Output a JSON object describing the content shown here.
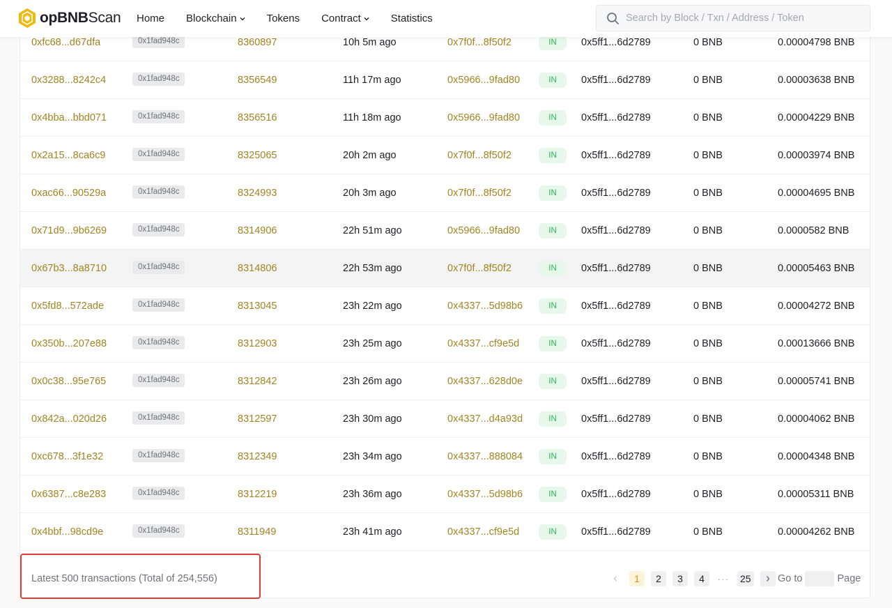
{
  "brand": {
    "name_bold": "opBNB",
    "name_regular": "Scan",
    "color": "#f0b90b"
  },
  "nav": {
    "home": "Home",
    "blockchain": "Blockchain",
    "tokens": "Tokens",
    "contract": "Contract",
    "statistics": "Statistics"
  },
  "search": {
    "placeholder": "Search by Block / Txn / Address / Token",
    "value": ""
  },
  "colors": {
    "link": "#a28521",
    "in_badge_bg": "#e7f7ea",
    "in_badge_text": "#2fb45a",
    "highlight": "#e23a36"
  },
  "transactions": [
    {
      "hash": "0xfc68...d67dfa",
      "method": "0x1fad948c",
      "block": "8360897",
      "age": "10h 5m ago",
      "from": "0x7f0f...8f50f2",
      "direction": "IN",
      "to": "0x5ff1...6d2789",
      "value": "0 BNB",
      "fee": "0.00004798 BNB"
    },
    {
      "hash": "0x3288...8242c4",
      "method": "0x1fad948c",
      "block": "8356549",
      "age": "11h 17m ago",
      "from": "0x5966...9fad80",
      "direction": "IN",
      "to": "0x5ff1...6d2789",
      "value": "0 BNB",
      "fee": "0.00003638 BNB"
    },
    {
      "hash": "0x4bba...bbd071",
      "method": "0x1fad948c",
      "block": "8356516",
      "age": "11h 18m ago",
      "from": "0x5966...9fad80",
      "direction": "IN",
      "to": "0x5ff1...6d2789",
      "value": "0 BNB",
      "fee": "0.00004229 BNB"
    },
    {
      "hash": "0x2a15...8ca6c9",
      "method": "0x1fad948c",
      "block": "8325065",
      "age": "20h 2m ago",
      "from": "0x7f0f...8f50f2",
      "direction": "IN",
      "to": "0x5ff1...6d2789",
      "value": "0 BNB",
      "fee": "0.00003974 BNB"
    },
    {
      "hash": "0xac66...90529a",
      "method": "0x1fad948c",
      "block": "8324993",
      "age": "20h 3m ago",
      "from": "0x7f0f...8f50f2",
      "direction": "IN",
      "to": "0x5ff1...6d2789",
      "value": "0 BNB",
      "fee": "0.00004695 BNB"
    },
    {
      "hash": "0x71d9...9b6269",
      "method": "0x1fad948c",
      "block": "8314906",
      "age": "22h 51m ago",
      "from": "0x5966...9fad80",
      "direction": "IN",
      "to": "0x5ff1...6d2789",
      "value": "0 BNB",
      "fee": "0.0000582 BNB"
    },
    {
      "hash": "0x67b3...8a8710",
      "method": "0x1fad948c",
      "block": "8314806",
      "age": "22h 53m ago",
      "from": "0x7f0f...8f50f2",
      "direction": "IN",
      "to": "0x5ff1...6d2789",
      "value": "0 BNB",
      "fee": "0.00005463 BNB"
    },
    {
      "hash": "0x5fd8...572ade",
      "method": "0x1fad948c",
      "block": "8313045",
      "age": "23h 22m ago",
      "from": "0x4337...5d98b6",
      "direction": "IN",
      "to": "0x5ff1...6d2789",
      "value": "0 BNB",
      "fee": "0.00004272 BNB"
    },
    {
      "hash": "0x350b...207e88",
      "method": "0x1fad948c",
      "block": "8312903",
      "age": "23h 25m ago",
      "from": "0x4337...cf9e5d",
      "direction": "IN",
      "to": "0x5ff1...6d2789",
      "value": "0 BNB",
      "fee": "0.00013666 BNB"
    },
    {
      "hash": "0x0c38...95e765",
      "method": "0x1fad948c",
      "block": "8312842",
      "age": "23h 26m ago",
      "from": "0x4337...628d0e",
      "direction": "IN",
      "to": "0x5ff1...6d2789",
      "value": "0 BNB",
      "fee": "0.00005741 BNB"
    },
    {
      "hash": "0x842a...020d26",
      "method": "0x1fad948c",
      "block": "8312597",
      "age": "23h 30m ago",
      "from": "0x4337...d4a93d",
      "direction": "IN",
      "to": "0x5ff1...6d2789",
      "value": "0 BNB",
      "fee": "0.00004062 BNB"
    },
    {
      "hash": "0xc678...3f1e32",
      "method": "0x1fad948c",
      "block": "8312349",
      "age": "23h 34m ago",
      "from": "0x4337...888084",
      "direction": "IN",
      "to": "0x5ff1...6d2789",
      "value": "0 BNB",
      "fee": "0.00004348 BNB"
    },
    {
      "hash": "0x6387...c8e283",
      "method": "0x1fad948c",
      "block": "8312219",
      "age": "23h 36m ago",
      "from": "0x4337...5d98b6",
      "direction": "IN",
      "to": "0x5ff1...6d2789",
      "value": "0 BNB",
      "fee": "0.00005311 BNB"
    },
    {
      "hash": "0x4bbf...98cd9e",
      "method": "0x1fad948c",
      "block": "8311949",
      "age": "23h 41m ago",
      "from": "0x4337...cf9e5d",
      "direction": "IN",
      "to": "0x5ff1...6d2789",
      "value": "0 BNB",
      "fee": "0.00004262 BNB"
    }
  ],
  "hovered_row": 6,
  "footer": {
    "summary": "Latest 500 transactions (Total of 254,556)",
    "pages": [
      "1",
      "2",
      "3",
      "4"
    ],
    "dots": "···",
    "last_page": "25",
    "current_page": "1",
    "goto_label": "Go to",
    "page_label": "Page",
    "goto_value": ""
  }
}
